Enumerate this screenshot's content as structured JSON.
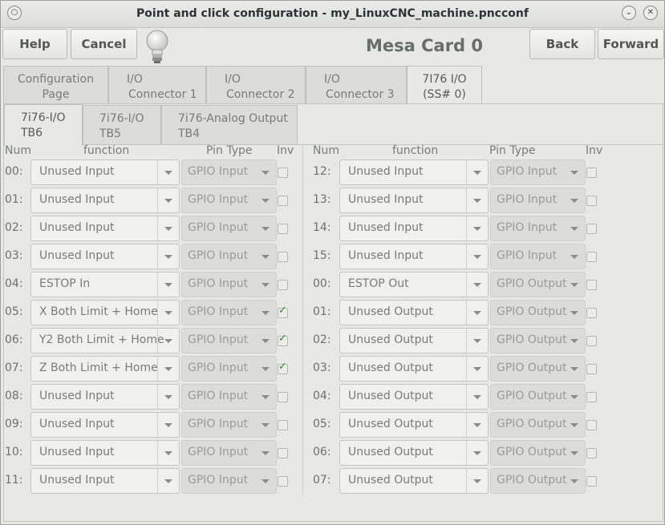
{
  "window": {
    "title": "Point and click configuration - my_LinuxCNC_machine.pncconf"
  },
  "toolbar": {
    "help_label": "Help",
    "cancel_label": "Cancel",
    "back_label": "Back",
    "forward_label": "Forward",
    "card_title": "Mesa Card 0"
  },
  "main_tabs": [
    {
      "line1": "Configuration",
      "line2": "Page"
    },
    {
      "line1": "I/O",
      "line2": "Connector 1"
    },
    {
      "line1": "I/O",
      "line2": "Connector 2"
    },
    {
      "line1": "I/O",
      "line2": "Connector 3"
    },
    {
      "line1": "7I76 I/O",
      "line2": "(SS# 0)"
    }
  ],
  "sub_tabs": [
    {
      "line1": "7i76-I/O",
      "line2": "TB6"
    },
    {
      "line1": "7i76-I/O",
      "line2": "TB5"
    },
    {
      "line1": "7i76-Analog Output",
      "line2": "TB4"
    }
  ],
  "headers": {
    "num": "Num",
    "function": "function",
    "pin_type": "Pin Type",
    "inv": "Inv"
  },
  "left_rows": [
    {
      "num": "00:",
      "function": "Unused Input",
      "pin_type": "GPIO Input",
      "inv": false
    },
    {
      "num": "01:",
      "function": "Unused Input",
      "pin_type": "GPIO Input",
      "inv": false
    },
    {
      "num": "02:",
      "function": "Unused Input",
      "pin_type": "GPIO Input",
      "inv": false
    },
    {
      "num": "03:",
      "function": "Unused Input",
      "pin_type": "GPIO Input",
      "inv": false
    },
    {
      "num": "04:",
      "function": "ESTOP In",
      "pin_type": "GPIO Input",
      "inv": false
    },
    {
      "num": "05:",
      "function": "X Both Limit + Home",
      "pin_type": "GPIO Input",
      "inv": true
    },
    {
      "num": "06:",
      "function": "Y2 Both Limit + Home",
      "pin_type": "GPIO Input",
      "inv": true
    },
    {
      "num": "07:",
      "function": "Z Both Limit + Home",
      "pin_type": "GPIO Input",
      "inv": true
    },
    {
      "num": "08:",
      "function": "Unused Input",
      "pin_type": "GPIO Input",
      "inv": false
    },
    {
      "num": "09:",
      "function": "Unused Input",
      "pin_type": "GPIO Input",
      "inv": false
    },
    {
      "num": "10:",
      "function": "Unused Input",
      "pin_type": "GPIO Input",
      "inv": false
    },
    {
      "num": "11:",
      "function": "Unused Input",
      "pin_type": "GPIO Input",
      "inv": false
    }
  ],
  "right_rows": [
    {
      "num": "12:",
      "function": "Unused Input",
      "pin_type": "GPIO Input",
      "inv": false
    },
    {
      "num": "13:",
      "function": "Unused Input",
      "pin_type": "GPIO Input",
      "inv": false
    },
    {
      "num": "14:",
      "function": "Unused Input",
      "pin_type": "GPIO Input",
      "inv": false
    },
    {
      "num": "15:",
      "function": "Unused Input",
      "pin_type": "GPIO Input",
      "inv": false
    },
    {
      "num": "00:",
      "function": "ESTOP Out",
      "pin_type": "GPIO Output",
      "inv": false
    },
    {
      "num": "01:",
      "function": "Unused Output",
      "pin_type": "GPIO Output",
      "inv": false
    },
    {
      "num": "02:",
      "function": "Unused Output",
      "pin_type": "GPIO Output",
      "inv": false
    },
    {
      "num": "03:",
      "function": "Unused Output",
      "pin_type": "GPIO Output",
      "inv": false
    },
    {
      "num": "04:",
      "function": "Unused Output",
      "pin_type": "GPIO Output",
      "inv": false
    },
    {
      "num": "05:",
      "function": "Unused Output",
      "pin_type": "GPIO Output",
      "inv": false
    },
    {
      "num": "06:",
      "function": "Unused Output",
      "pin_type": "GPIO Output",
      "inv": false
    },
    {
      "num": "07:",
      "function": "Unused Output",
      "pin_type": "GPIO Output",
      "inv": false
    }
  ]
}
